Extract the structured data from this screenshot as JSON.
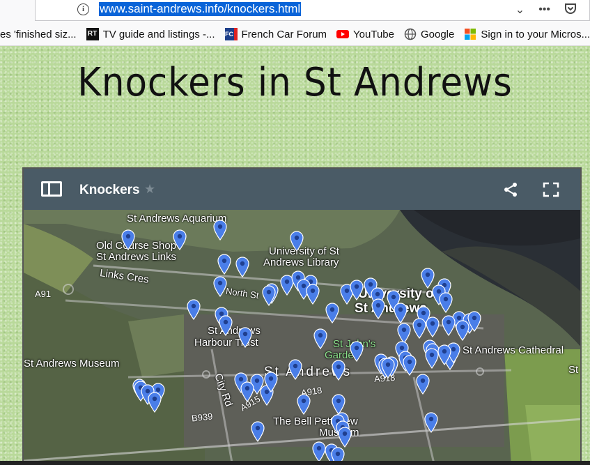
{
  "browser": {
    "url": "www.saint-andrews.info/knockers.html",
    "bookmarks": [
      {
        "label": "es 'finished siz...",
        "icon": "page-icon"
      },
      {
        "label": "TV guide and listings -...",
        "icon": "rt-icon"
      },
      {
        "label": "French Car Forum",
        "icon": "fcf-icon"
      },
      {
        "label": "YouTube",
        "icon": "youtube-icon"
      },
      {
        "label": "Google",
        "icon": "globe-icon"
      },
      {
        "label": "Sign in to your Micros...",
        "icon": "microsoft-icon"
      }
    ]
  },
  "page": {
    "title": "Knockers in St Andrews"
  },
  "map": {
    "title": "Knockers",
    "labels": {
      "aquarium": "St Andrews Aquarium",
      "old_course_1": "Old Course Shop",
      "old_course_2": "St Andrews Links",
      "library_1": "University of St",
      "library_2": "Andrews Library",
      "links_cres": "Links Cres",
      "north_st": "North St",
      "university_1": "University of",
      "university_2": "St Andrews",
      "harbour_1": "St Andrews",
      "harbour_2": "Harbour Trust",
      "johns_1": "St John's",
      "johns_2": "Garden",
      "cathedral": "St Andrews Cathedral",
      "museum": "St Andrews Museum",
      "town": "St Andrews",
      "city_rd": "City Rd",
      "bell_1": "The Bell Pettigrew",
      "bell_2": "Museum",
      "st": "St",
      "a91": "A91",
      "a918a": "A918",
      "a918b": "A918",
      "a915": "A915",
      "b939": "B939"
    }
  }
}
